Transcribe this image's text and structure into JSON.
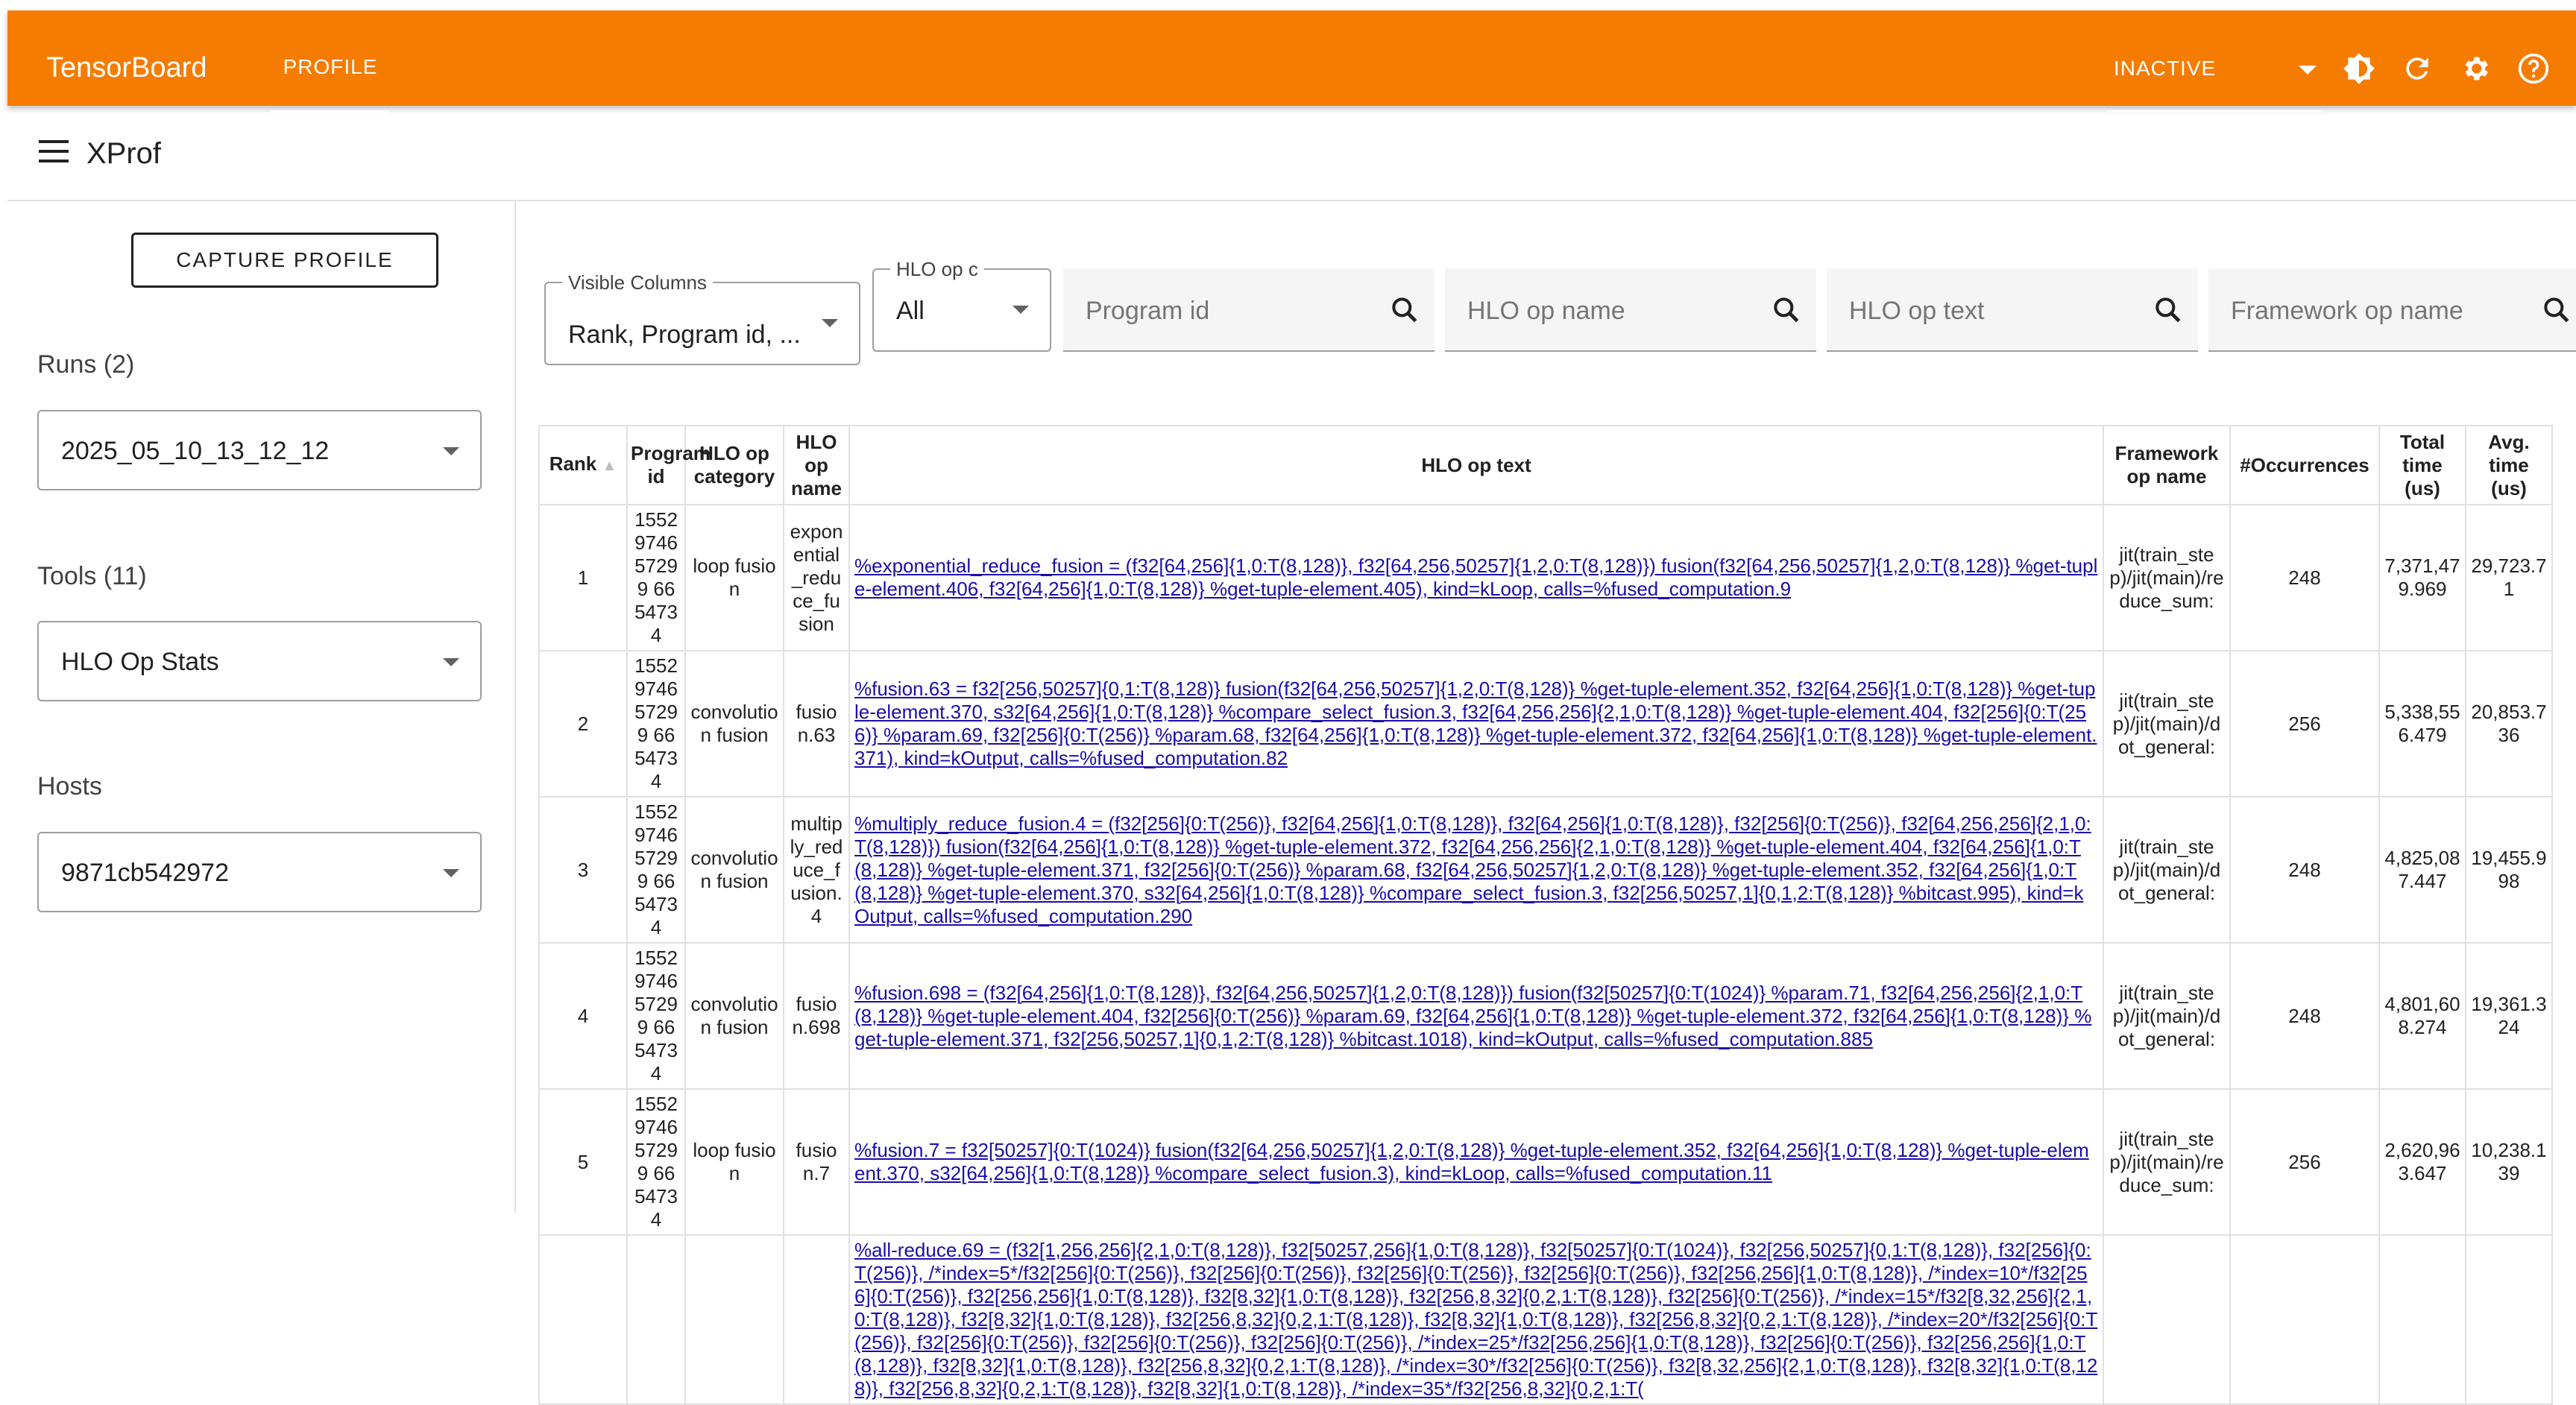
{
  "app": {
    "brand": "TensorBoard",
    "tab": "PROFILE",
    "run_status": "INACTIVE"
  },
  "header": {
    "title": "XProf"
  },
  "sidebar": {
    "capture_button": "CAPTURE PROFILE",
    "runs_label": "Runs (2)",
    "run_value": "2025_05_10_13_12_12",
    "tools_label": "Tools (11)",
    "tool_value": "HLO Op Stats",
    "hosts_label": "Hosts",
    "host_value": "9871cb542972"
  },
  "filters": {
    "visible_columns_label": "Visible Columns",
    "visible_columns_value": "Rank, Program id, ...",
    "hlo_category_label": "HLO op c",
    "hlo_category_value": "All",
    "search_program_id": "Program id",
    "search_hlo_op_name": "HLO op name",
    "search_hlo_op_text": "HLO op text",
    "search_framework_op_name": "Framework op name"
  },
  "icons": {
    "theme": "brightness-icon",
    "refresh": "refresh-icon",
    "settings": "settings-icon",
    "help": "help-icon",
    "search": "search-icon"
  },
  "colors": {
    "toolbar": "#f57c00",
    "link": "#1a0dab"
  },
  "table": {
    "headers": {
      "rank": "Rank",
      "program_id": "Program id",
      "hlo_op_category": "HLO op category",
      "hlo_op_name": "HLO op name",
      "hlo_op_text": "HLO op text",
      "framework_op_name": "Framework op name",
      "occurrences": "#Occurrences",
      "total_time": "Total time (us)",
      "avg_time": "Avg. time (us)"
    },
    "rows": [
      {
        "rank": "1",
        "program_id": "1552974657299 6654734",
        "category": "loop fusion",
        "op_name": "exponential_reduce_fusion",
        "op_text": "%exponential_reduce_fusion = (f32[64,256]{1,0:T(8,128)}, f32[64,256,50257]{1,2,0:T(8,128)}) fusion(f32[64,256,50257]{1,2,0:T(8,128)} %get-tuple-element.406, f32[64,256]{1,0:T(8,128)} %get-tuple-element.405), kind=kLoop, calls=%fused_computation.9",
        "framework_op": "jit(train_step)/jit(main)/reduce_sum:",
        "occurrences": "248",
        "total": "7,371,479.969",
        "avg": "29,723.71"
      },
      {
        "rank": "2",
        "program_id": "1552974657299 6654734",
        "category": "convolution fusion",
        "op_name": "fusion.63",
        "op_text": "%fusion.63 = f32[256,50257]{0,1:T(8,128)} fusion(f32[64,256,50257]{1,2,0:T(8,128)} %get-tuple-element.352, f32[64,256]{1,0:T(8,128)} %get-tuple-element.370, s32[64,256]{1,0:T(8,128)} %compare_select_fusion.3, f32[64,256,256]{2,1,0:T(8,128)} %get-tuple-element.404, f32[256]{0:T(256)} %param.69, f32[256]{0:T(256)} %param.68, f32[64,256]{1,0:T(8,128)} %get-tuple-element.372, f32[64,256]{1,0:T(8,128)} %get-tuple-element.371), kind=kOutput, calls=%fused_computation.82",
        "framework_op": "jit(train_step)/jit(main)/dot_general:",
        "occurrences": "256",
        "total": "5,338,556.479",
        "avg": "20,853.736"
      },
      {
        "rank": "3",
        "program_id": "1552974657299 6654734",
        "category": "convolution fusion",
        "op_name": "multiply_reduce_fusion.4",
        "op_text": "%multiply_reduce_fusion.4 = (f32[256]{0:T(256)}, f32[64,256]{1,0:T(8,128)}, f32[64,256]{1,0:T(8,128)}, f32[256]{0:T(256)}, f32[64,256,256]{2,1,0:T(8,128)}) fusion(f32[64,256]{1,0:T(8,128)} %get-tuple-element.372, f32[64,256,256]{2,1,0:T(8,128)} %get-tuple-element.404, f32[64,256]{1,0:T(8,128)} %get-tuple-element.371, f32[256]{0:T(256)} %param.68, f32[64,256,50257]{1,2,0:T(8,128)} %get-tuple-element.352, f32[64,256]{1,0:T(8,128)} %get-tuple-element.370, s32[64,256]{1,0:T(8,128)} %compare_select_fusion.3, f32[256,50257,1]{0,1,2:T(8,128)} %bitcast.995), kind=kOutput, calls=%fused_computation.290",
        "framework_op": "jit(train_step)/jit(main)/dot_general:",
        "occurrences": "248",
        "total": "4,825,087.447",
        "avg": "19,455.998"
      },
      {
        "rank": "4",
        "program_id": "1552974657299 6654734",
        "category": "convolution fusion",
        "op_name": "fusion.698",
        "op_text": "%fusion.698 = (f32[64,256]{1,0:T(8,128)}, f32[64,256,50257]{1,2,0:T(8,128)}) fusion(f32[50257]{0:T(1024)} %param.71, f32[64,256,256]{2,1,0:T(8,128)} %get-tuple-element.404, f32[256]{0:T(256)} %param.69, f32[64,256]{1,0:T(8,128)} %get-tuple-element.372, f32[64,256]{1,0:T(8,128)} %get-tuple-element.371, f32[256,50257,1]{0,1,2:T(8,128)} %bitcast.1018), kind=kOutput, calls=%fused_computation.885",
        "framework_op": "jit(train_step)/jit(main)/dot_general:",
        "occurrences": "248",
        "total": "4,801,608.274",
        "avg": "19,361.324"
      },
      {
        "rank": "5",
        "program_id": "1552974657299 6654734",
        "category": "loop fusion",
        "op_name": "fusion.7",
        "op_text": "%fusion.7 = f32[50257]{0:T(1024)} fusion(f32[64,256,50257]{1,2,0:T(8,128)} %get-tuple-element.352, f32[64,256]{1,0:T(8,128)} %get-tuple-element.370, s32[64,256]{1,0:T(8,128)} %compare_select_fusion.3), kind=kLoop, calls=%fused_computation.11",
        "framework_op": "jit(train_step)/jit(main)/reduce_sum:",
        "occurrences": "256",
        "total": "2,620,963.647",
        "avg": "10,238.139"
      },
      {
        "rank": "",
        "program_id": "",
        "category": "",
        "op_name": "",
        "op_text": "%all-reduce.69 = (f32[1,256,256]{2,1,0:T(8,128)}, f32[50257,256]{1,0:T(8,128)}, f32[50257]{0:T(1024)}, f32[256,50257]{0,1:T(8,128)}, f32[256]{0:T(256)}, /*index=5*/f32[256]{0:T(256)}, f32[256]{0:T(256)}, f32[256]{0:T(256)}, f32[256]{0:T(256)}, f32[256,256]{1,0:T(8,128)}, /*index=10*/f32[256]{0:T(256)}, f32[256,256]{1,0:T(8,128)}, f32[8,32]{1,0:T(8,128)}, f32[256,8,32]{0,2,1:T(8,128)}, f32[256]{0:T(256)}, /*index=15*/f32[8,32,256]{2,1,0:T(8,128)}, f32[8,32]{1,0:T(8,128)}, f32[256,8,32]{0,2,1:T(8,128)}, f32[8,32]{1,0:T(8,128)}, f32[256,8,32]{0,2,1:T(8,128)}, /*index=20*/f32[256]{0:T(256)}, f32[256]{0:T(256)}, f32[256]{0:T(256)}, f32[256]{0:T(256)}, /*index=25*/f32[256,256]{1,0:T(8,128)}, f32[256]{0:T(256)}, f32[256,256]{1,0:T(8,128)}, f32[8,32]{1,0:T(8,128)}, f32[256,8,32]{0,2,1:T(8,128)}, /*index=30*/f32[256]{0:T(256)}, f32[8,32,256]{2,1,0:T(8,128)}, f32[8,32]{1,0:T(8,128)}, f32[256,8,32]{0,2,1:T(8,128)}, f32[8,32]{1,0:T(8,128)}, /*index=35*/f32[256,8,32]{0,2,1:T(",
        "framework_op": "",
        "occurrences": "",
        "total": "",
        "avg": ""
      }
    ]
  }
}
